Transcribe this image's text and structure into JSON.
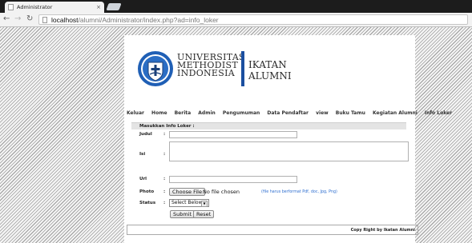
{
  "browser": {
    "tab_title": "Administrator",
    "tab_close": "×",
    "url_host": "localhost",
    "url_path": "/alumni/Administrator/index.php?ad=info_loker"
  },
  "header": {
    "university_line1": "UNIVERSITAS",
    "university_line2": "METHODIST",
    "university_line3": "INDONESIA",
    "org_line1": "IKATAN",
    "org_line2": "ALUMNI",
    "accent_color": "#1b4fa0"
  },
  "menu": [
    "Keluar",
    "Home",
    "Berita",
    "Admin",
    "Pengumuman",
    "Data Pendaftar",
    "view",
    "Buku Tamu",
    "Kegiatan Alumni",
    "Info Loker"
  ],
  "form": {
    "heading": "Masukkan Info Loker :",
    "judul_label": "Judul",
    "isi_label": "Isi",
    "url_label": "Url",
    "photo_label": "Photo",
    "status_label": "Status",
    "colon": ":",
    "choose_file": "Choose File",
    "no_file": "No file chosen",
    "file_hint": "(file harus berformat Pdf, doc, Jpg, Png)",
    "status_selected": "Select Below",
    "submit": "Submit",
    "reset": "Reset"
  },
  "footer": {
    "copyright": "Copy Right by Ikatan Alumni"
  }
}
